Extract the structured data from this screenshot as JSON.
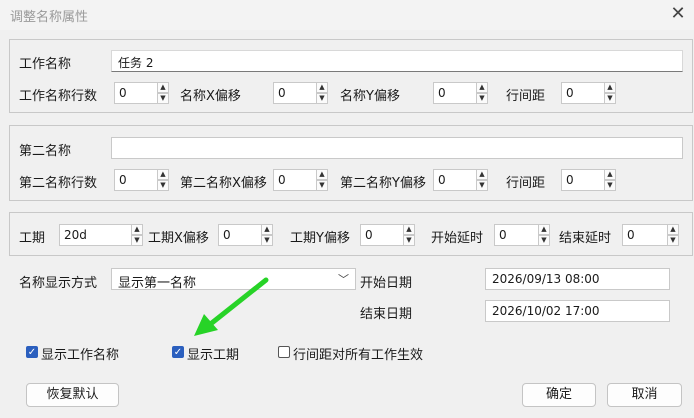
{
  "window": {
    "title": "调整名称属性",
    "close_icon": "close-icon"
  },
  "group1": {
    "name_label": "工作名称",
    "name_value": "任务 2",
    "rows_label": "工作名称行数",
    "rows_value": "0",
    "x_offset_label": "名称X偏移",
    "x_offset_value": "0",
    "y_offset_label": "名称Y偏移",
    "y_offset_value": "0",
    "line_spacing_label": "行间距",
    "line_spacing_value": "0"
  },
  "group2": {
    "name_label": "第二名称",
    "name_value": "",
    "rows_label": "第二名称行数",
    "rows_value": "0",
    "x_offset_label": "第二名称X偏移",
    "x_offset_value": "0",
    "y_offset_label": "第二名称Y偏移",
    "y_offset_value": "0",
    "line_spacing_label": "行间距",
    "line_spacing_value": "0"
  },
  "group3": {
    "duration_label": "工期",
    "duration_value": "20d",
    "duration_x_label": "工期X偏移",
    "duration_x_value": "0",
    "duration_y_label": "工期Y偏移",
    "duration_y_value": "0",
    "start_delay_label": "开始延时",
    "start_delay_value": "0",
    "end_delay_label": "结束延时",
    "end_delay_value": "0"
  },
  "display": {
    "mode_label": "名称显示方式",
    "mode_value": "显示第一名称",
    "start_date_label": "开始日期",
    "start_date_value": "2026/09/13 08:00",
    "end_date_label": "结束日期",
    "end_date_value": "2026/10/02 17:00"
  },
  "checkboxes": {
    "show_name_label": "显示工作名称",
    "show_name_checked": true,
    "show_duration_label": "显示工期",
    "show_duration_checked": true,
    "apply_spacing_label": "行间距对所有工作生效",
    "apply_spacing_checked": false
  },
  "buttons": {
    "restore_default": "恢复默认",
    "ok": "确定",
    "cancel": "取消"
  },
  "annotation": {
    "arrow_color": "#27d327"
  }
}
